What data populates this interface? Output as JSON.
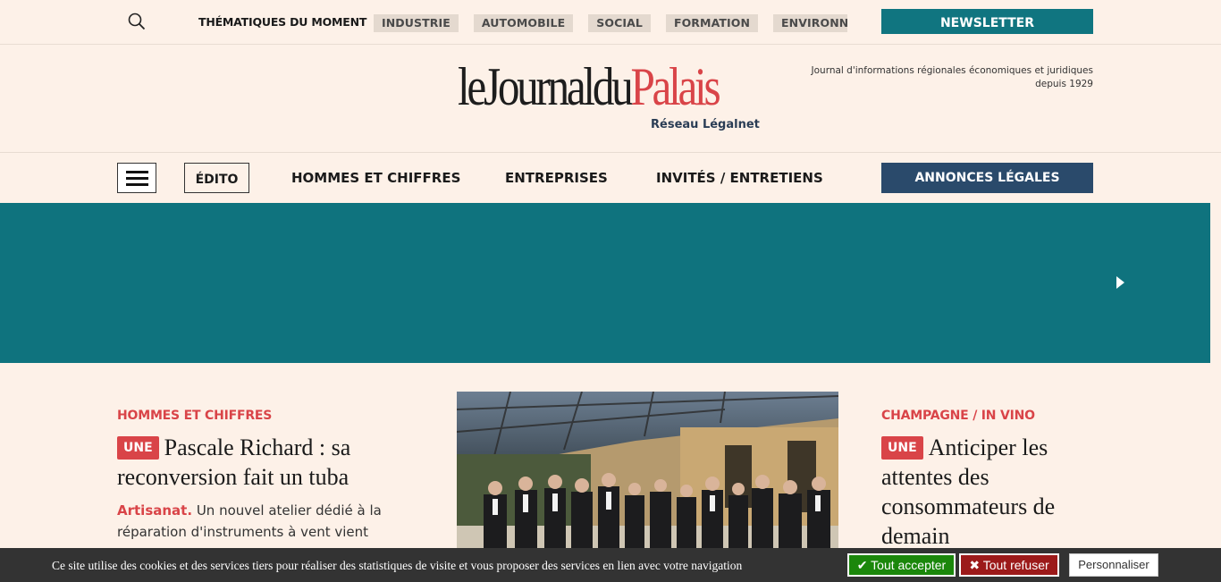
{
  "topbar": {
    "thematiques_label": "THÉMATIQUES DU MOMENT",
    "tags": [
      "INDUSTRIE",
      "AUTOMOBILE",
      "SOCIAL",
      "FORMATION",
      "ENVIRONNEMENT"
    ],
    "newsletter_label": "NEWSLETTER"
  },
  "header": {
    "logo_part1": "leJournaldu",
    "logo_part2": "Palais",
    "logo_sub1": "Réseau",
    "logo_sub2": "Légalnet",
    "tagline": "Journal d'informations régionales économiques et juridiques depuis 1929"
  },
  "nav": {
    "edito": "ÉDITO",
    "links": [
      "HOMMES ET CHIFFRES",
      "ENTREPRISES",
      "INVITÉS / ENTRETIENS"
    ],
    "annonces": "ANNONCES LÉGALES"
  },
  "articles": {
    "left": {
      "category": "HOMMES ET CHIFFRES",
      "badge": "UNE",
      "title": "Pascale Richard : sa reconversion fait un tuba",
      "excerpt_lead": "Artisanat.",
      "excerpt": "Un nouvel atelier dédié à la réparation d'instruments à vent vient"
    },
    "right": {
      "category": "CHAMPAGNE / IN VINO",
      "badge": "UNE",
      "title": "Anticiper les attentes des consommateurs de demain"
    }
  },
  "cookie": {
    "text": "Ce site utilise des cookies et des services tiers pour réaliser des statistiques de visite et vous proposer des services en lien avec votre navigation",
    "accept": "Tout accepter",
    "refuse": "Tout refuser",
    "customize": "Personnaliser"
  },
  "colors": {
    "background": "#fdf1e8",
    "teal": "#0f737e",
    "accent_red": "#d94448",
    "navy": "#2a4a6b"
  }
}
